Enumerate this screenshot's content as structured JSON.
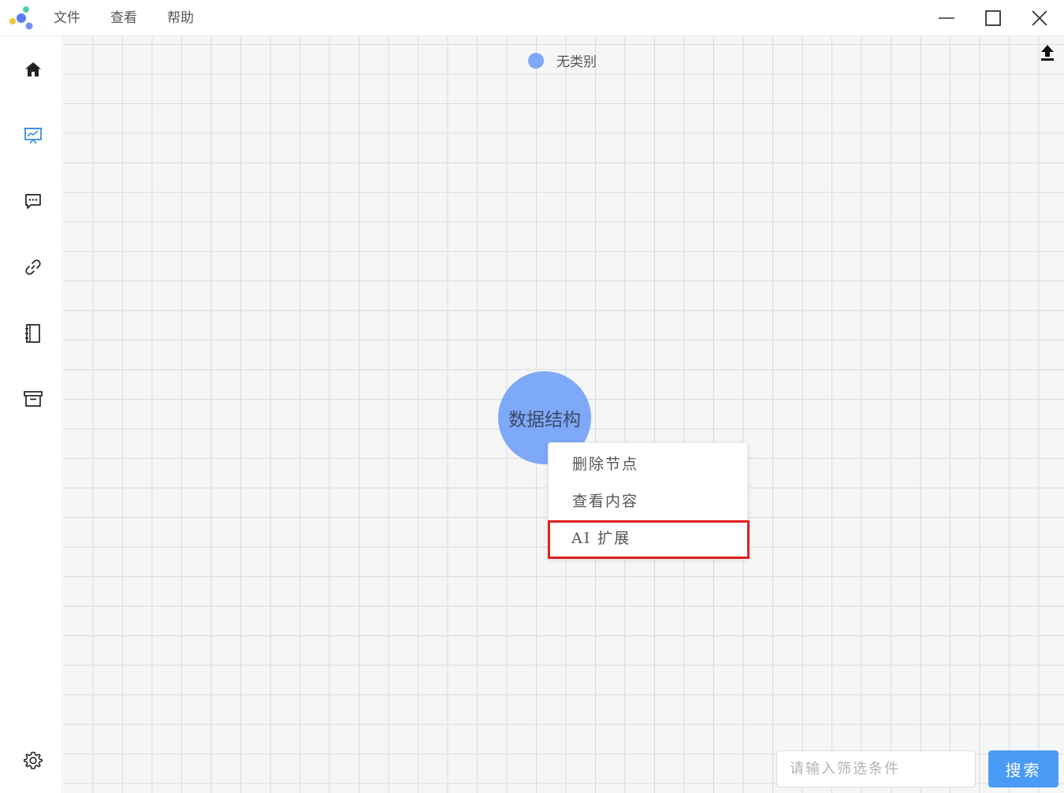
{
  "menu": {
    "items": [
      {
        "label": "文件"
      },
      {
        "label": "查看"
      },
      {
        "label": "帮助"
      }
    ]
  },
  "sidebar": {
    "items": [
      {
        "icon": "home-icon"
      },
      {
        "icon": "presentation-chart-icon",
        "active": true
      },
      {
        "icon": "chat-icon"
      },
      {
        "icon": "link-icon"
      },
      {
        "icon": "notebook-icon"
      },
      {
        "icon": "archive-icon"
      },
      {
        "icon": "gear-icon"
      }
    ]
  },
  "legend": {
    "label": "无类别",
    "color": "#7ea8f8"
  },
  "node": {
    "label": "数据结构",
    "color": "#7ea8f8"
  },
  "context_menu": {
    "items": [
      {
        "label": "删除节点"
      },
      {
        "label": "查看内容"
      },
      {
        "label": "AI 扩展",
        "highlighted": true
      }
    ]
  },
  "search": {
    "placeholder": "请输入筛选条件",
    "value": "",
    "button_label": "搜索"
  },
  "colors": {
    "accent": "#4a9bf5",
    "highlight_border": "#e02020"
  }
}
